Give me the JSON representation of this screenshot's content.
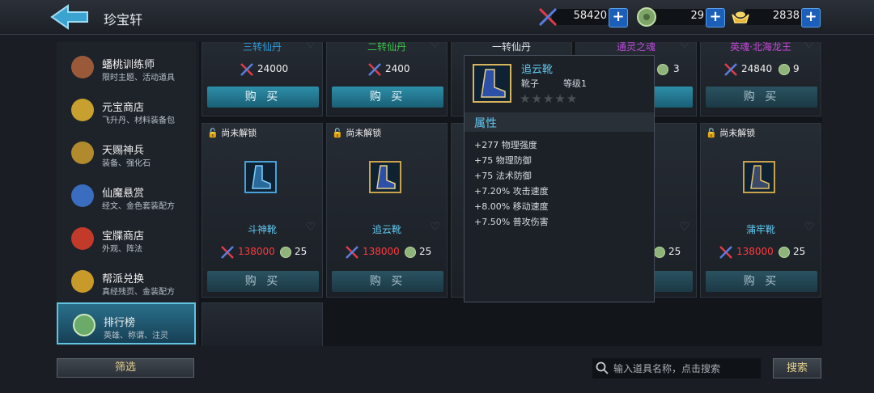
{
  "header": {
    "title": "珍宝轩"
  },
  "currencies": [
    {
      "icon": "crossed-swords-icon",
      "value": "58420"
    },
    {
      "icon": "jade-coin-icon",
      "value": "29"
    },
    {
      "icon": "gold-ingot-icon",
      "value": "2838"
    }
  ],
  "sidebar": {
    "items": [
      {
        "name": "蟠桃训练师",
        "sub": "限时主题、活动道具",
        "icon": "peach-icon"
      },
      {
        "name": "元宝商店",
        "sub": "飞升丹、材料装备包",
        "icon": "gold-pot-icon"
      },
      {
        "name": "天赐神兵",
        "sub": "装备、强化石",
        "icon": "divine-weapon-icon"
      },
      {
        "name": "仙魔悬赏",
        "sub": "经文、金色套装配方",
        "icon": "bounty-icon"
      },
      {
        "name": "宝牒商店",
        "sub": "外观、阵法",
        "icon": "scroll-shop-icon"
      },
      {
        "name": "帮派兑换",
        "sub": "真经残页、金装配方",
        "icon": "guild-bag-icon"
      },
      {
        "name": "排行榜",
        "sub": "英雄、称谓、注灵",
        "icon": "ranking-icon"
      }
    ]
  },
  "shop": {
    "row1": [
      {
        "name": "三转仙丹",
        "price": "24000",
        "price2": ""
      },
      {
        "name": "二转仙丹",
        "price": "2400",
        "price2": ""
      },
      {
        "name": "一转仙丹",
        "price": "",
        "price2": ""
      },
      {
        "name": "通灵之魂",
        "price": "",
        "price2": "3"
      },
      {
        "name": "英魂·北海龙王",
        "price": "24840",
        "price2": "9"
      }
    ],
    "row2": [
      {
        "name": "斗神靴",
        "price": "138000",
        "price2": "25"
      },
      {
        "name": "追云靴",
        "price": "138000",
        "price2": "25"
      },
      {
        "name": "",
        "price": "",
        "price2": ""
      },
      {
        "name": "",
        "price": "",
        "price2": "25"
      },
      {
        "name": "蒲牢靴",
        "price": "138000",
        "price2": "25"
      }
    ],
    "lock_label": "尚未解锁",
    "buy_label": "购 买"
  },
  "tooltip": {
    "name": "追云靴",
    "type": "靴子",
    "level": "等级1",
    "stars": "★★★★★",
    "section": "属性",
    "stats": [
      "+277 物理强度",
      "+75 物理防御",
      "+75 法术防御",
      "+7.20% 攻击速度",
      "+8.00% 移动速度",
      "+7.50% 普攻伤害"
    ]
  },
  "footer": {
    "filter_label": "筛选",
    "search_placeholder": "输入道具名称，点击搜索",
    "search_label": "搜索"
  },
  "colors": {
    "accent": "#5fc9f0",
    "price_red": "#ff3b3b",
    "button_teal": "#2c8fa8"
  }
}
